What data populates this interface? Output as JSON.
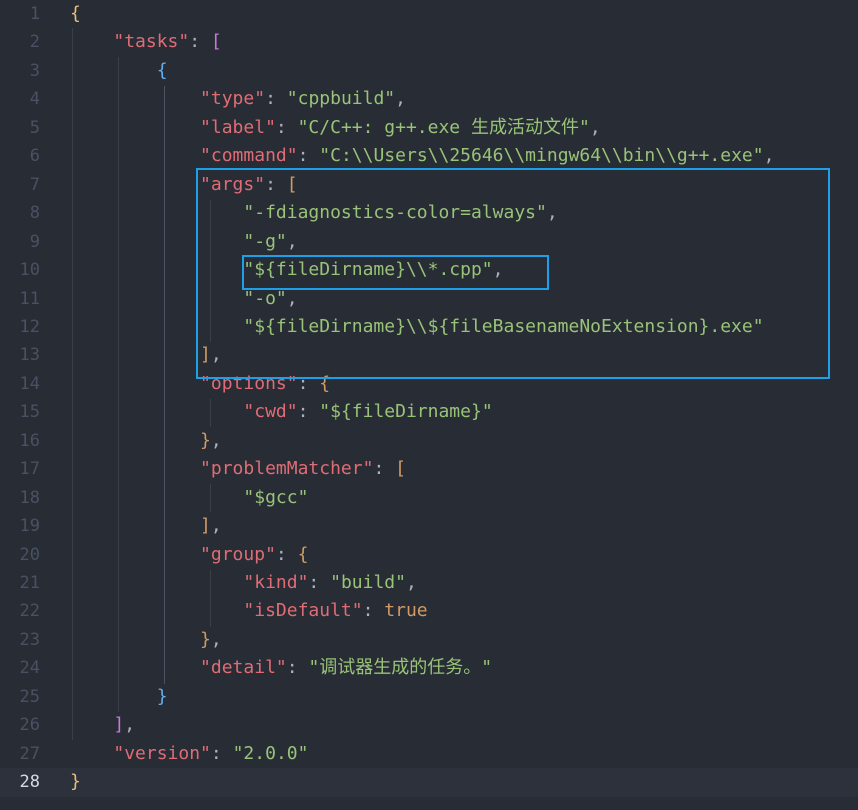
{
  "editor": {
    "current_line": 28,
    "highlight_color": "#1ea0e8",
    "lines": [
      {
        "n": "1",
        "tokens": [
          {
            "t": "{",
            "c": "b"
          }
        ]
      },
      {
        "n": "2",
        "tokens": [
          {
            "t": "    "
          },
          {
            "t": "\"tasks\"",
            "c": "k"
          },
          {
            "t": ": ",
            "c": "p"
          },
          {
            "t": "[",
            "c": "bp"
          }
        ]
      },
      {
        "n": "3",
        "tokens": [
          {
            "t": "        "
          },
          {
            "t": "{",
            "c": "bb"
          }
        ]
      },
      {
        "n": "4",
        "tokens": [
          {
            "t": "            "
          },
          {
            "t": "\"type\"",
            "c": "k"
          },
          {
            "t": ": ",
            "c": "p"
          },
          {
            "t": "\"cppbuild\"",
            "c": "s"
          },
          {
            "t": ",",
            "c": "p"
          }
        ]
      },
      {
        "n": "5",
        "tokens": [
          {
            "t": "            "
          },
          {
            "t": "\"label\"",
            "c": "k"
          },
          {
            "t": ": ",
            "c": "p"
          },
          {
            "t": "\"C/C++: g++.exe 生成活动文件\"",
            "c": "s"
          },
          {
            "t": ",",
            "c": "p"
          }
        ]
      },
      {
        "n": "6",
        "tokens": [
          {
            "t": "            "
          },
          {
            "t": "\"command\"",
            "c": "k"
          },
          {
            "t": ": ",
            "c": "p"
          },
          {
            "t": "\"C:\\\\Users\\\\25646\\\\mingw64\\\\bin\\\\g++.exe\"",
            "c": "s"
          },
          {
            "t": ",",
            "c": "p"
          }
        ]
      },
      {
        "n": "7",
        "tokens": [
          {
            "t": "            "
          },
          {
            "t": "\"args\"",
            "c": "k"
          },
          {
            "t": ": ",
            "c": "p"
          },
          {
            "t": "[",
            "c": "bo"
          }
        ]
      },
      {
        "n": "8",
        "tokens": [
          {
            "t": "                "
          },
          {
            "t": "\"-fdiagnostics-color=always\"",
            "c": "s"
          },
          {
            "t": ",",
            "c": "p"
          }
        ]
      },
      {
        "n": "9",
        "tokens": [
          {
            "t": "                "
          },
          {
            "t": "\"-g\"",
            "c": "s"
          },
          {
            "t": ",",
            "c": "p"
          }
        ]
      },
      {
        "n": "10",
        "tokens": [
          {
            "t": "                "
          },
          {
            "t": "\"${fileDirname}\\\\*.cpp\"",
            "c": "s"
          },
          {
            "t": ",",
            "c": "p"
          }
        ]
      },
      {
        "n": "11",
        "tokens": [
          {
            "t": "                "
          },
          {
            "t": "\"-o\"",
            "c": "s"
          },
          {
            "t": ",",
            "c": "p"
          }
        ]
      },
      {
        "n": "12",
        "tokens": [
          {
            "t": "                "
          },
          {
            "t": "\"${fileDirname}\\\\${fileBasenameNoExtension}.exe\"",
            "c": "s"
          }
        ]
      },
      {
        "n": "13",
        "tokens": [
          {
            "t": "            "
          },
          {
            "t": "]",
            "c": "bo"
          },
          {
            "t": ",",
            "c": "p"
          }
        ]
      },
      {
        "n": "14",
        "tokens": [
          {
            "t": "            "
          },
          {
            "t": "\"options\"",
            "c": "k"
          },
          {
            "t": ": ",
            "c": "p"
          },
          {
            "t": "{",
            "c": "bo"
          }
        ]
      },
      {
        "n": "15",
        "tokens": [
          {
            "t": "                "
          },
          {
            "t": "\"cwd\"",
            "c": "k"
          },
          {
            "t": ": ",
            "c": "p"
          },
          {
            "t": "\"${fileDirname}\"",
            "c": "s"
          }
        ]
      },
      {
        "n": "16",
        "tokens": [
          {
            "t": "            "
          },
          {
            "t": "}",
            "c": "bo"
          },
          {
            "t": ",",
            "c": "p"
          }
        ]
      },
      {
        "n": "17",
        "tokens": [
          {
            "t": "            "
          },
          {
            "t": "\"problemMatcher\"",
            "c": "k"
          },
          {
            "t": ": ",
            "c": "p"
          },
          {
            "t": "[",
            "c": "bo"
          }
        ]
      },
      {
        "n": "18",
        "tokens": [
          {
            "t": "                "
          },
          {
            "t": "\"$gcc\"",
            "c": "s"
          }
        ]
      },
      {
        "n": "19",
        "tokens": [
          {
            "t": "            "
          },
          {
            "t": "]",
            "c": "bo"
          },
          {
            "t": ",",
            "c": "p"
          }
        ]
      },
      {
        "n": "20",
        "tokens": [
          {
            "t": "            "
          },
          {
            "t": "\"group\"",
            "c": "k"
          },
          {
            "t": ": ",
            "c": "p"
          },
          {
            "t": "{",
            "c": "bo"
          }
        ]
      },
      {
        "n": "21",
        "tokens": [
          {
            "t": "                "
          },
          {
            "t": "\"kind\"",
            "c": "k"
          },
          {
            "t": ": ",
            "c": "p"
          },
          {
            "t": "\"build\"",
            "c": "s"
          },
          {
            "t": ",",
            "c": "p"
          }
        ]
      },
      {
        "n": "22",
        "tokens": [
          {
            "t": "                "
          },
          {
            "t": "\"isDefault\"",
            "c": "k"
          },
          {
            "t": ": ",
            "c": "p"
          },
          {
            "t": "true",
            "c": "n"
          }
        ]
      },
      {
        "n": "23",
        "tokens": [
          {
            "t": "            "
          },
          {
            "t": "}",
            "c": "bo"
          },
          {
            "t": ",",
            "c": "p"
          }
        ]
      },
      {
        "n": "24",
        "tokens": [
          {
            "t": "            "
          },
          {
            "t": "\"detail\"",
            "c": "k"
          },
          {
            "t": ": ",
            "c": "p"
          },
          {
            "t": "\"调试器生成的任务。\"",
            "c": "s"
          }
        ]
      },
      {
        "n": "25",
        "tokens": [
          {
            "t": "        "
          },
          {
            "t": "}",
            "c": "bb"
          }
        ]
      },
      {
        "n": "26",
        "tokens": [
          {
            "t": "    "
          },
          {
            "t": "]",
            "c": "bp"
          },
          {
            "t": ",",
            "c": "p"
          }
        ]
      },
      {
        "n": "27",
        "tokens": [
          {
            "t": "    "
          },
          {
            "t": "\"version\"",
            "c": "k"
          },
          {
            "t": ": ",
            "c": "p"
          },
          {
            "t": "\"2.0.0\"",
            "c": "s"
          }
        ]
      },
      {
        "n": "28",
        "tokens": [
          {
            "t": "}",
            "c": "b"
          }
        ]
      }
    ]
  }
}
